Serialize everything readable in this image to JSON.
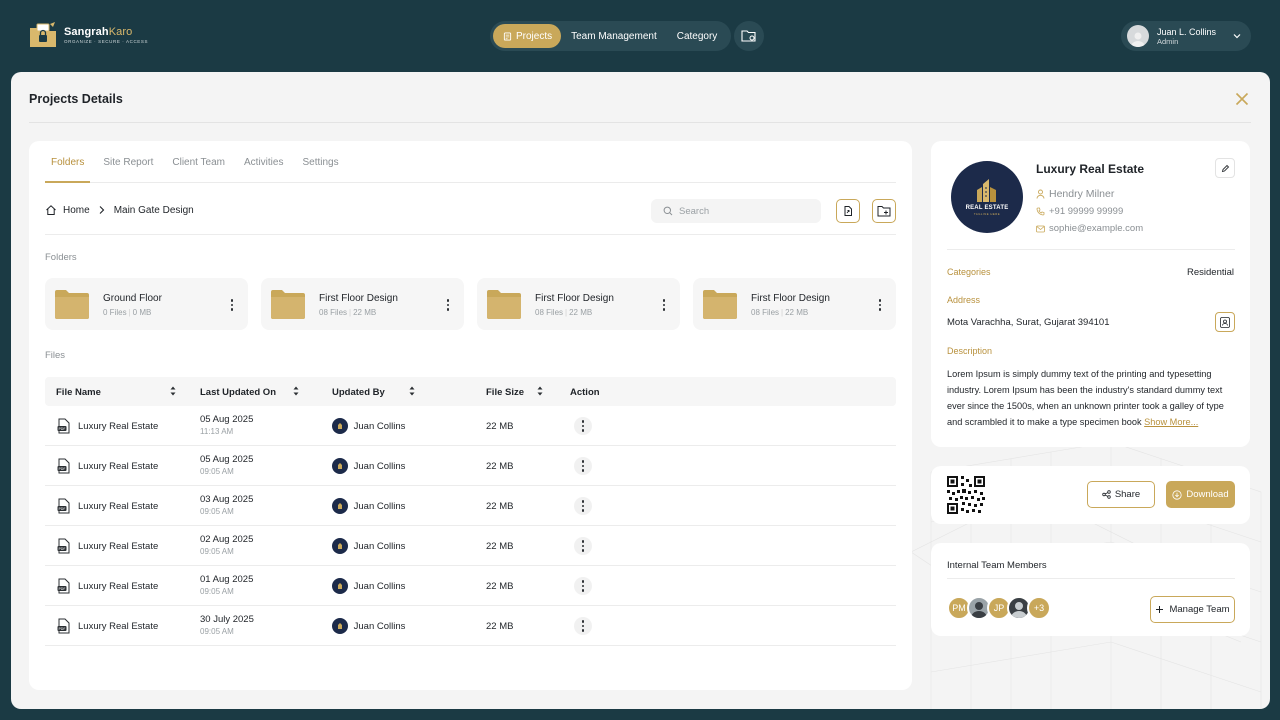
{
  "app": {
    "logo_name_bold": "Sangrah",
    "logo_name_light": "Karo",
    "logo_tagline": "ORGANIZE · SECURE · ACCESS"
  },
  "nav": {
    "items": [
      {
        "label": "Projects",
        "active": true
      },
      {
        "label": "Team Management",
        "active": false
      },
      {
        "label": "Category",
        "active": false
      }
    ]
  },
  "user": {
    "name": "Juan L. Collins",
    "role": "Admin"
  },
  "modal": {
    "title": "Projects Details"
  },
  "tabs": [
    {
      "label": "Folders",
      "active": true
    },
    {
      "label": "Site Report",
      "active": false
    },
    {
      "label": "Client Team",
      "active": false
    },
    {
      "label": "Activities",
      "active": false
    },
    {
      "label": "Settings",
      "active": false
    }
  ],
  "breadcrumb": {
    "home": "Home",
    "current": "Main Gate Design"
  },
  "search": {
    "placeholder": "Search"
  },
  "folders_section": {
    "label": "Folders"
  },
  "folders": [
    {
      "name": "Ground Floor",
      "files": "0 Files",
      "size": "0 MB"
    },
    {
      "name": "First Floor Design",
      "files": "08 Files",
      "size": "22 MB"
    },
    {
      "name": "First Floor Design",
      "files": "08 Files",
      "size": "22 MB"
    },
    {
      "name": "First Floor Design",
      "files": "08 Files",
      "size": "22 MB"
    }
  ],
  "files_section": {
    "label": "Files"
  },
  "table": {
    "headers": {
      "file_name": "File Name",
      "last_updated": "Last Updated On",
      "updated_by": "Updated By",
      "file_size": "File Size",
      "action": "Action"
    },
    "rows": [
      {
        "name": "Luxury Real Estate",
        "date": "05 Aug 2025",
        "time": "11:13 AM",
        "by": "Juan Collins",
        "size": "22 MB"
      },
      {
        "name": "Luxury Real Estate",
        "date": "05 Aug 2025",
        "time": "09:05 AM",
        "by": "Juan Collins",
        "size": "22 MB"
      },
      {
        "name": "Luxury Real Estate",
        "date": "03 Aug 2025",
        "time": "09:05 AM",
        "by": "Juan Collins",
        "size": "22 MB"
      },
      {
        "name": "Luxury Real Estate",
        "date": "02 Aug 2025",
        "time": "09:05 AM",
        "by": "Juan Collins",
        "size": "22 MB"
      },
      {
        "name": "Luxury Real Estate",
        "date": "01 Aug 2025",
        "time": "09:05 AM",
        "by": "Juan Collins",
        "size": "22 MB"
      },
      {
        "name": "Luxury Real Estate",
        "date": "30 July 2025",
        "time": "09:05 AM",
        "by": "Juan Collins",
        "size": "22 MB"
      }
    ]
  },
  "project": {
    "logo_text": "REAL ESTATE",
    "logo_subtext": "TAGLINE HERE",
    "title": "Luxury Real Estate",
    "contact_name": "Hendry Milner",
    "phone": "+91 99999 99999",
    "email": "sophie@example.com",
    "categories_label": "Categories",
    "categories_value": "Residential",
    "address_label": "Address",
    "address_value": "Mota Varachha, Surat, Gujarat 394101",
    "description_label": "Description",
    "description": "Lorem Ipsum is simply dummy text of the printing and typesetting industry. Lorem Ipsum has been the industry's standard dummy text ever since the 1500s, when an unknown printer took a galley of type and scrambled it to make a type specimen book",
    "show_more": "Show More..."
  },
  "share": {
    "share_label": "Share",
    "download_label": "Download"
  },
  "team": {
    "title": "Internal Team Members",
    "members": [
      {
        "initials": "PM",
        "color": "#c9a85a"
      },
      {
        "initials": "",
        "color": "#9aa3a8"
      },
      {
        "initials": "JP",
        "color": "#c9a85a"
      },
      {
        "initials": "",
        "color": "#3a3f44"
      }
    ],
    "more": "+3",
    "manage_label": "Manage Team"
  },
  "colors": {
    "accent": "#c9a85a",
    "header_bg": "#1b3a44",
    "nav_dark": "#1c2a4a"
  }
}
